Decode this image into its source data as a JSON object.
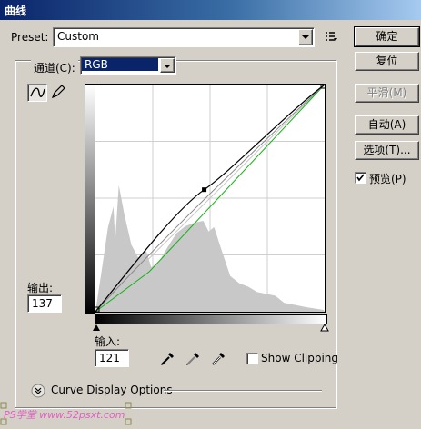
{
  "window": {
    "title": "曲线"
  },
  "preset": {
    "label": "Preset:",
    "value": "Custom"
  },
  "channel": {
    "label": "通道(C):",
    "value": "RGB"
  },
  "buttons": {
    "ok": "确定",
    "reset": "复位",
    "smooth": "平滑(M)",
    "auto": "自动(A)",
    "options": "选项(T)..."
  },
  "preview": {
    "label": "预览(P)",
    "checked": true
  },
  "output": {
    "label": "输出:",
    "value": "137"
  },
  "input": {
    "label": "输入:",
    "value": "121"
  },
  "show_clipping": {
    "label": "Show Clipping",
    "checked": false
  },
  "curve_display_options": {
    "label": "Curve Display Options"
  },
  "watermark": {
    "text": "PS学堂 www.52psxt.com"
  },
  "colors": {
    "histogram": "#c8c8c8",
    "baseline": "#14b414",
    "curve": "#000000",
    "grid": "#cfcfcf"
  },
  "icons": [
    "curve-tool-icon",
    "pencil-tool-icon",
    "preset-options-icon",
    "black-eyedropper-icon",
    "gray-eyedropper-icon",
    "white-eyedropper-icon",
    "expand-icon"
  ]
}
